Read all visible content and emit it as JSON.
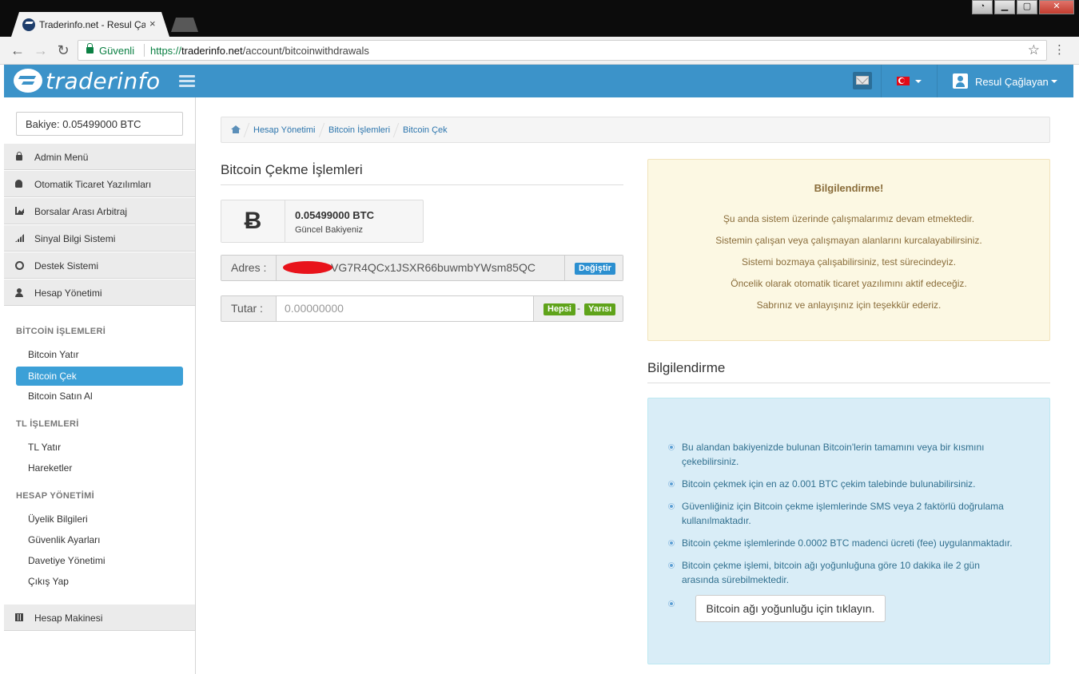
{
  "browser": {
    "tab_title": "Traderinfo.net - Resul Ça",
    "tab_close": "×",
    "secure_label": "Güvenli",
    "url_proto": "https://",
    "url_host": "traderinfo.net",
    "url_path": "/account/bitcoinwithdrawals",
    "window_controls": [
      "user-icon",
      "minimize-icon",
      "maximize-icon",
      "close-icon"
    ]
  },
  "header": {
    "logo_text": "traderinfo",
    "user_name": "Resul Çağlayan",
    "colors": {
      "bar": "#3c93c9",
      "accent": "#3ca0d7"
    }
  },
  "sidebar": {
    "balance": "Bakiye: 0.05499000 BTC",
    "menu": [
      {
        "label": "Admin Menü",
        "icon": "lock-icon"
      },
      {
        "label": "Otomatik Ticaret Yazılımları",
        "icon": "android-icon"
      },
      {
        "label": "Borsalar Arası Arbitraj",
        "icon": "area-chart-icon"
      },
      {
        "label": "Sinyal Bilgi Sistemi",
        "icon": "signal-icon"
      },
      {
        "label": "Destek Sistemi",
        "icon": "support-icon"
      },
      {
        "label": "Hesap Yönetimi",
        "icon": "user-icon"
      }
    ],
    "sections": [
      {
        "title": "BİTCOİN İŞLEMLERİ",
        "links": [
          "Bitcoin Yatır",
          "Bitcoin Çek",
          "Bitcoin Satın Al"
        ]
      },
      {
        "title": "TL İŞLEMLERİ",
        "links": [
          "TL Yatır",
          "Hareketler"
        ]
      },
      {
        "title": "HESAP YÖNETİMİ",
        "links": [
          "Üyelik Bilgileri",
          "Güvenlik Ayarları",
          "Davetiye Yönetimi",
          "Çıkış Yap"
        ]
      }
    ],
    "active_link": "Bitcoin Çek",
    "calculator": {
      "label": "Hesap Makinesi",
      "icon": "calculator-icon"
    }
  },
  "breadcrumb": [
    "Hesap Yönetimi",
    "Bitcoin İşlemleri",
    "Bitcoin Çek"
  ],
  "withdraw": {
    "heading": "Bitcoin Çekme İşlemleri",
    "btc_symbol": "Ƀ",
    "balance_value": "0.05499000 BTC",
    "balance_sub": "Güncel Bakiyeniz",
    "address_label": "Adres :",
    "address_value": "VG7R4QCx1JSXR66buwmbYWsm85QC",
    "change_label": "Değiştir",
    "amount_label": "Tutar  :",
    "amount_placeholder": "0.00000000",
    "all_label": "Hepsi",
    "dash": "-",
    "half_label": "Yarısı"
  },
  "notice": {
    "title": "Bilgilendirme!",
    "lines": [
      "Şu anda sistem üzerinde çalışmalarımız devam etmektedir.",
      "Sistemin çalışan veya çalışmayan alanlarını kurcalayabilirsiniz.",
      "Sistemi bozmaya çalışabilirsiniz, test sürecindeyiz.",
      "Öncelik olarak otomatik ticaret yazılımını aktif edeceğiz.",
      "Sabrınız ve anlayışınız için teşekkür ederiz."
    ]
  },
  "info": {
    "heading": "Bilgilendirme",
    "items": [
      "Bu alandan bakiyenizde bulunan Bitcoin'lerin tamamını veya bir kısmını çekebilirsiniz.",
      "Bitcoin çekmek için en az 0.001 BTC çekim talebinde bulunabilirsiniz.",
      "Güvenliğiniz için Bitcoin çekme işlemlerinde SMS veya 2 faktörlü doğrulama kullanılmaktadır.",
      "Bitcoin çekme işlemlerinde 0.0002 BTC madenci ücreti (fee) uygulanmaktadır.",
      "Bitcoin çekme işlemi, bitcoin ağı yoğunluğuna göre 10 dakika ile 2 gün arasında sürebilmektedir."
    ],
    "network_button": "Bitcoin ağı yoğunluğu için tıklayın."
  }
}
